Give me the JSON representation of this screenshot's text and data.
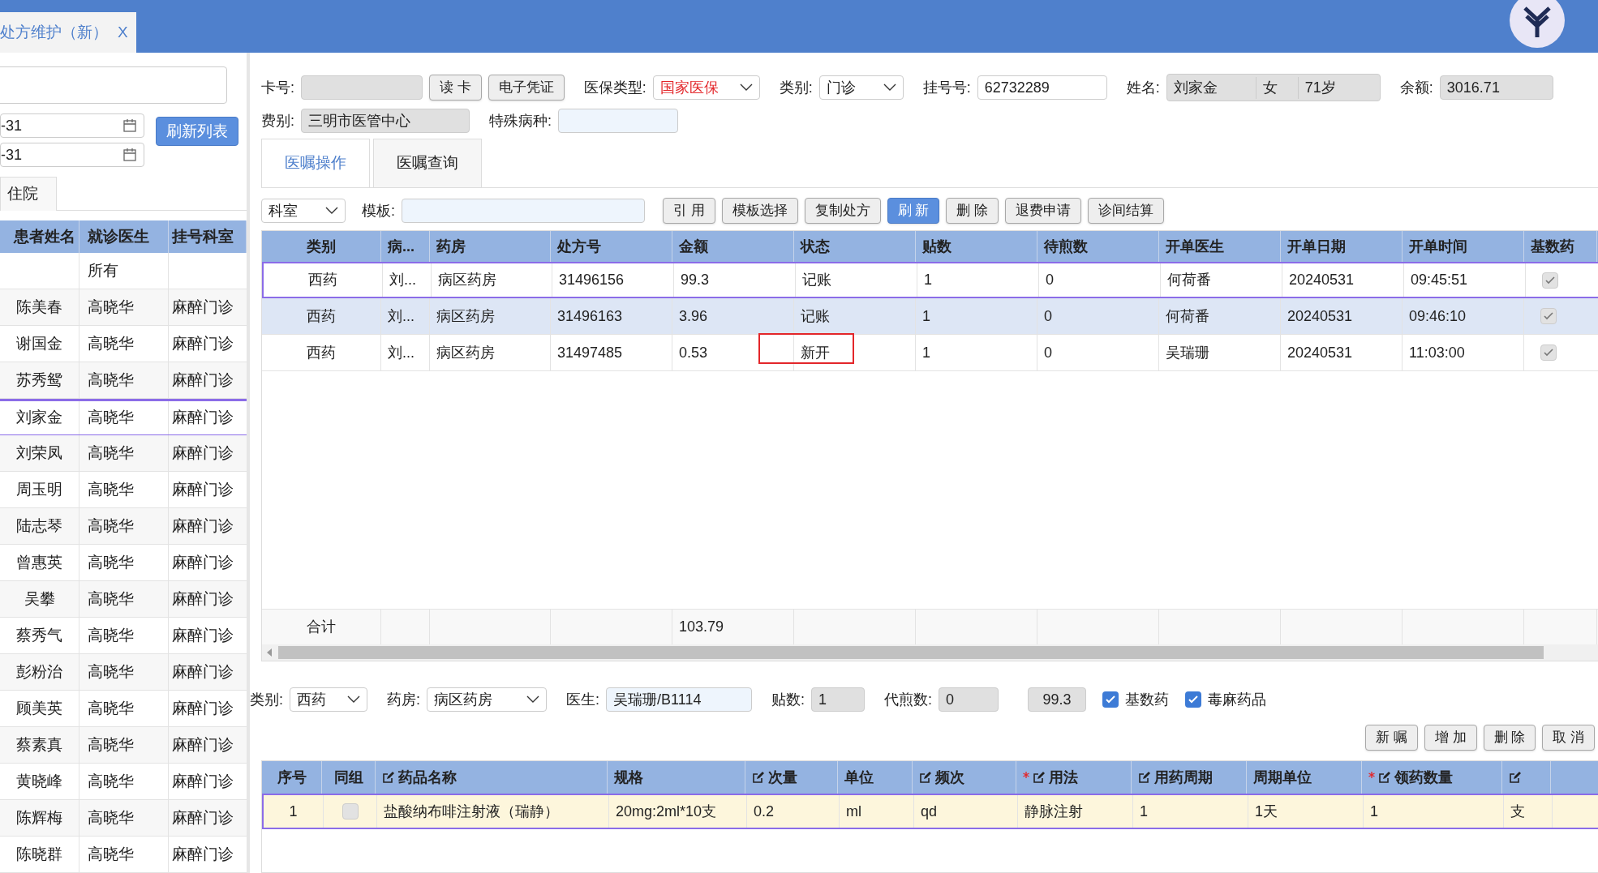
{
  "window_tab": {
    "title": "处方维护（新）",
    "close": "X"
  },
  "left_panel": {
    "date_from": "-31",
    "date_to": "-31",
    "refresh_button": "刷新列表",
    "tab": "住院",
    "columns": [
      "患者姓名",
      "就诊医生",
      "挂号科室"
    ],
    "rows": [
      {
        "name": "",
        "doctor": "所有",
        "dept": "",
        "selected": false
      },
      {
        "name": "陈美春",
        "doctor": "高晓华",
        "dept": "麻醉门诊",
        "selected": false
      },
      {
        "name": "谢国金",
        "doctor": "高晓华",
        "dept": "麻醉门诊",
        "selected": false
      },
      {
        "name": "苏秀鸳",
        "doctor": "高晓华",
        "dept": "麻醉门诊",
        "selected": false
      },
      {
        "name": "刘家金",
        "doctor": "高晓华",
        "dept": "麻醉门诊",
        "selected": true
      },
      {
        "name": "刘荣凤",
        "doctor": "高晓华",
        "dept": "麻醉门诊",
        "selected": false
      },
      {
        "name": "周玉明",
        "doctor": "高晓华",
        "dept": "麻醉门诊",
        "selected": false
      },
      {
        "name": "陆志琴",
        "doctor": "高晓华",
        "dept": "麻醉门诊",
        "selected": false
      },
      {
        "name": "曾惠英",
        "doctor": "高晓华",
        "dept": "麻醉门诊",
        "selected": false
      },
      {
        "name": "吴攀",
        "doctor": "高晓华",
        "dept": "麻醉门诊",
        "selected": false
      },
      {
        "name": "蔡秀气",
        "doctor": "高晓华",
        "dept": "麻醉门诊",
        "selected": false
      },
      {
        "name": "彭粉治",
        "doctor": "高晓华",
        "dept": "麻醉门诊",
        "selected": false
      },
      {
        "name": "顾美英",
        "doctor": "高晓华",
        "dept": "麻醉门诊",
        "selected": false
      },
      {
        "name": "蔡素真",
        "doctor": "高晓华",
        "dept": "麻醉门诊",
        "selected": false
      },
      {
        "name": "黄晓峰",
        "doctor": "高晓华",
        "dept": "麻醉门诊",
        "selected": false
      },
      {
        "name": "陈辉梅",
        "doctor": "高晓华",
        "dept": "麻醉门诊",
        "selected": false
      },
      {
        "name": "陈晓群",
        "doctor": "高晓华",
        "dept": "麻醉门诊",
        "selected": false
      }
    ]
  },
  "patient_bar": {
    "card_label": "卡号:",
    "read_card": "读 卡",
    "e_voucher": "电子凭证",
    "insurance_label": "医保类型:",
    "insurance": "国家医保",
    "category_label": "类别:",
    "category": "门诊",
    "reg_label": "挂号号:",
    "reg_no": "62732289",
    "name_label": "姓名:",
    "name": "刘家金",
    "sex": "女",
    "age": "71岁",
    "balance_label": "余额:",
    "balance": "3016.71",
    "fee_label": "费别:",
    "fee": "三明市医管中心",
    "disease_label": "特殊病种:"
  },
  "tabs": [
    {
      "label": "医嘱操作",
      "selected": true
    },
    {
      "label": "医嘱查询",
      "selected": false
    }
  ],
  "toolbar": {
    "dept": "科室",
    "template_label": "模板:",
    "buttons": [
      {
        "label": "引 用",
        "primary": false
      },
      {
        "label": "模板选择",
        "primary": false
      },
      {
        "label": "复制处方",
        "primary": false
      },
      {
        "label": "刷 新",
        "primary": true
      },
      {
        "label": "删 除",
        "primary": false
      },
      {
        "label": "退费申请",
        "primary": false
      },
      {
        "label": "诊间结算",
        "primary": false
      }
    ]
  },
  "rx_table": {
    "columns": [
      "类别",
      "病...",
      "药房",
      "处方号",
      "金额",
      "状态",
      "贴数",
      "待煎数",
      "开单医生",
      "开单日期",
      "开单时间",
      "基数药"
    ],
    "rows": [
      {
        "cells": [
          "西药",
          "刘...",
          "病区药房",
          "31496156",
          "99.3",
          "记账",
          "1",
          "0",
          "何荷番",
          "20240531",
          "09:45:51"
        ],
        "base_drug": true,
        "selected": true,
        "status_marked": false
      },
      {
        "cells": [
          "西药",
          "刘...",
          "病区药房",
          "31496163",
          "3.96",
          "记账",
          "1",
          "0",
          "何荷番",
          "20240531",
          "09:46:10"
        ],
        "base_drug": true,
        "selected": false,
        "status_marked": false
      },
      {
        "cells": [
          "西药",
          "刘...",
          "病区药房",
          "31497485",
          "0.53",
          "新开",
          "1",
          "0",
          "吴瑞珊",
          "20240531",
          "11:03:00"
        ],
        "base_drug": true,
        "selected": false,
        "status_marked": true
      }
    ],
    "total_label": "合计",
    "total": "103.79"
  },
  "detail_form": {
    "category_label": "类别:",
    "category": "西药",
    "pharmacy_label": "药房:",
    "pharmacy": "病区药房",
    "doctor_label": "医生:",
    "doctor": "吴瑞珊/B1114",
    "doses_label": "贴数:",
    "doses": "1",
    "decoct_label": "代煎数:",
    "decoct": "0",
    "amount": "99.3",
    "checks": [
      {
        "label": "基数药",
        "checked": true
      },
      {
        "label": "毒麻药品",
        "checked": true
      }
    ],
    "buttons": [
      "新 嘱",
      "增 加",
      "删 除",
      "取 消"
    ]
  },
  "drug_table": {
    "columns": [
      {
        "label": "序号",
        "editable": false,
        "required": false
      },
      {
        "label": "同组",
        "editable": false,
        "required": false
      },
      {
        "label": "药品名称",
        "editable": true,
        "required": false
      },
      {
        "label": "规格",
        "editable": false,
        "required": false
      },
      {
        "label": "次量",
        "editable": true,
        "required": false
      },
      {
        "label": "单位",
        "editable": false,
        "required": false
      },
      {
        "label": "频次",
        "editable": true,
        "required": false
      },
      {
        "label": "用法",
        "editable": true,
        "required": true
      },
      {
        "label": "用药周期",
        "editable": true,
        "required": false
      },
      {
        "label": "周期单位",
        "editable": false,
        "required": false
      },
      {
        "label": "领药数量",
        "editable": true,
        "required": true
      },
      {
        "editable": true,
        "required": false
      }
    ],
    "rows": [
      {
        "cells": [
          "1",
          "",
          "盐酸纳布啡注射液（瑞静）",
          "20mg:2ml*10支",
          "0.2",
          "ml",
          "qd",
          "静脉注射",
          "1",
          "1天",
          "1",
          "支"
        ],
        "same_group": false,
        "selected": true
      }
    ]
  }
}
